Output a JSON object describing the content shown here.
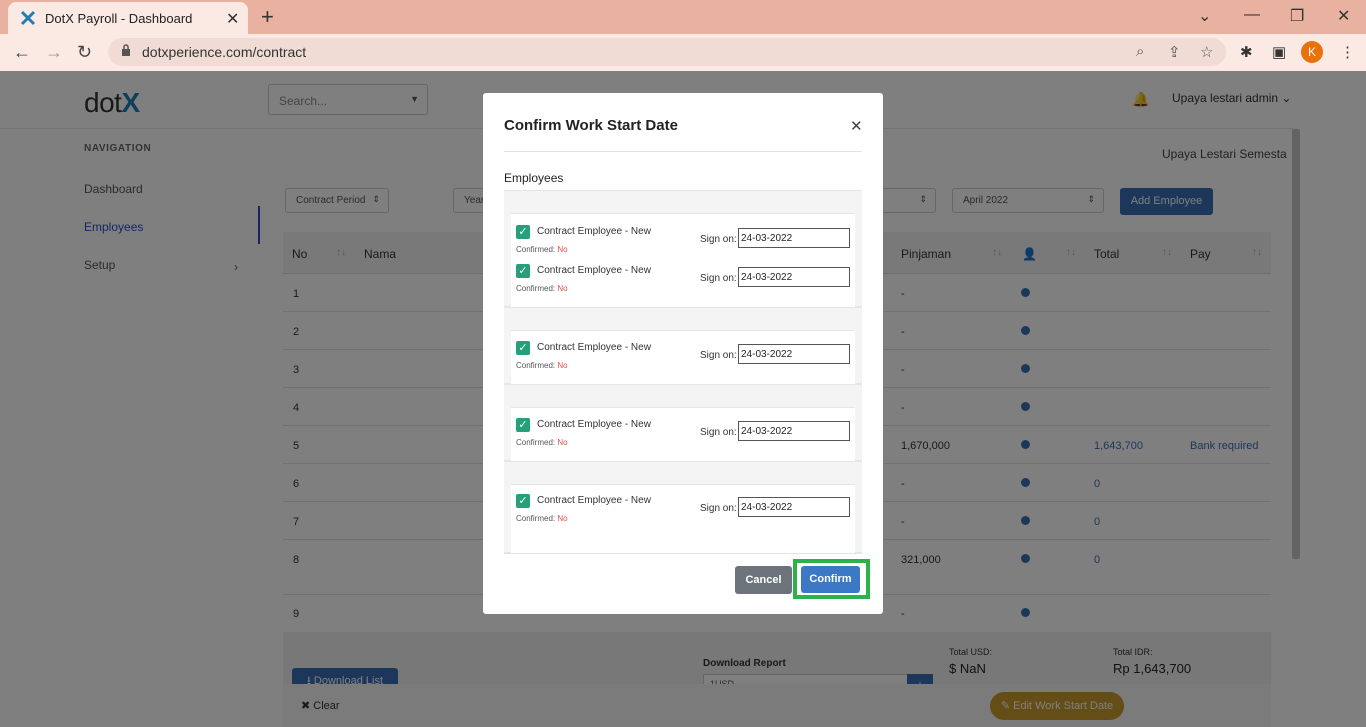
{
  "browser": {
    "tab_title": "DotX Payroll - Dashboard",
    "url": "dotxperience.com/contract",
    "profile_initial": "K"
  },
  "header": {
    "logo_text": "dot",
    "logo_mark": "X",
    "search_placeholder": "Search...",
    "user_name": "Upaya lestari admin"
  },
  "sidebar": {
    "heading": "NAVIGATION",
    "items": [
      {
        "label": "Dashboard"
      },
      {
        "label": "Employees"
      },
      {
        "label": "Setup"
      }
    ]
  },
  "main": {
    "company": "Upaya Lestari Semesta",
    "filters": [
      "Contract Period",
      "Year",
      "April 2022"
    ],
    "add_button": "Add Employee",
    "columns": [
      "No",
      "Nama",
      "Pinjaman",
      "Total",
      "Pay"
    ],
    "rows": [
      {
        "no": "1",
        "pinjaman": "-",
        "total": "",
        "pay": ""
      },
      {
        "no": "2",
        "pinjaman": "-",
        "total": "",
        "pay": ""
      },
      {
        "no": "3",
        "pinjaman": "-",
        "total": "",
        "pay": ""
      },
      {
        "no": "4",
        "pinjaman": "-",
        "total": "",
        "pay": ""
      },
      {
        "no": "5",
        "pinjaman": "1,670,000",
        "total": "1,643,700",
        "pay": "Bank required"
      },
      {
        "no": "6",
        "pinjaman": "-",
        "total": "0",
        "pay": ""
      },
      {
        "no": "7",
        "pinjaman": "-",
        "total": "0",
        "pay": ""
      },
      {
        "no": "8",
        "pinjaman": "321,000",
        "total": "0",
        "pay": ""
      },
      {
        "no": "9",
        "pinjaman": "-",
        "total": "",
        "pay": ""
      }
    ],
    "download_button": "Download List",
    "download_report": "Download Report",
    "currency_input": "1USD",
    "total_usd_label": "Total USD:",
    "total_usd_value": "$ NaN",
    "total_idr_label": "Total IDR:",
    "total_idr_value": "Rp 1,643,700",
    "clear_button": "Clear",
    "edit_button": "Edit Work Start Date"
  },
  "modal": {
    "title": "Confirm Work Start Date",
    "section": "Employees",
    "employees": [
      {
        "label": "Contract Employee - New",
        "confirmed_label": "Confirmed:",
        "confirmed": "No",
        "sign_label": "Sign on:",
        "date": "24-03-2022"
      },
      {
        "label": "Contract Employee - New",
        "confirmed_label": "Confirmed:",
        "confirmed": "No",
        "sign_label": "Sign on:",
        "date": "24-03-2022"
      },
      {
        "label": "Contract Employee - New",
        "confirmed_label": "Confirmed:",
        "confirmed": "No",
        "sign_label": "Sign on:",
        "date": "24-03-2022"
      },
      {
        "label": "Contract Employee - New",
        "confirmed_label": "Confirmed:",
        "confirmed": "No",
        "sign_label": "Sign on:",
        "date": "24-03-2022"
      },
      {
        "label": "Contract Employee - New",
        "confirmed_label": "Confirmed:",
        "confirmed": "No",
        "sign_label": "Sign on:",
        "date": "24-03-2022"
      }
    ],
    "cancel_label": "Cancel",
    "confirm_label": "Confirm"
  },
  "colors": {
    "accent": "#3b6fb6",
    "checkbox": "#26a07a",
    "highlight": "#2db24a",
    "warning_button": "#c89a2e"
  }
}
